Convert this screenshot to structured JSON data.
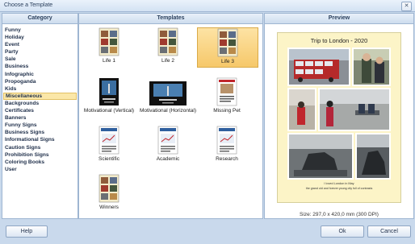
{
  "window": {
    "title": "Choose a Template",
    "close_glyph": "✕"
  },
  "category": {
    "header": "Category",
    "selected": "Miscellaneous",
    "items": [
      "Funny",
      "Holiday",
      "Event",
      "Party",
      "Sale",
      "Business",
      "Infographic",
      "Propoganda",
      "Kids",
      "Miscellaneous",
      "Backgrounds",
      "Certificates",
      "Banners",
      "Funny Signs",
      "Business Signs",
      "Informational Signs",
      "Caution Signs",
      "Prohibition Signs",
      "Coloring Books",
      "User"
    ]
  },
  "templates": {
    "header": "Templates",
    "selected": "Life 3",
    "items": [
      {
        "label": "Life 1",
        "thumb_style": "collage-portrait"
      },
      {
        "label": "Life 2",
        "thumb_style": "collage-portrait"
      },
      {
        "label": "Life 3",
        "thumb_style": "collage-portrait"
      },
      {
        "label": "Motivational (Vertical)",
        "thumb_style": "dark-portrait"
      },
      {
        "label": "Motivational (Horizontal)",
        "thumb_style": "dark-landscape"
      },
      {
        "label": "Missing Pet",
        "thumb_style": "poster-portrait"
      },
      {
        "label": "Scientific",
        "thumb_style": "chart-portrait"
      },
      {
        "label": "Academic",
        "thumb_style": "chart-portrait"
      },
      {
        "label": "Research",
        "thumb_style": "chart-portrait"
      },
      {
        "label": "Winners",
        "thumb_style": "collage-portrait"
      }
    ]
  },
  "preview": {
    "header": "Preview",
    "poster_title": "Trip to London - 2020",
    "caption_line1": "I loved London in May",
    "caption_line2": "the grand old and forever young city full of contrasts",
    "size_text": "Size: 297,0 x 420,0 mm (300 DPI)",
    "card_color": "#fcf4c7"
  },
  "buttons": {
    "help": "Help",
    "ok": "Ok",
    "cancel": "Cancel"
  },
  "colors": {
    "accent": "#f6c86a",
    "frame": "#c9d9ec",
    "header": "#cddcee"
  }
}
